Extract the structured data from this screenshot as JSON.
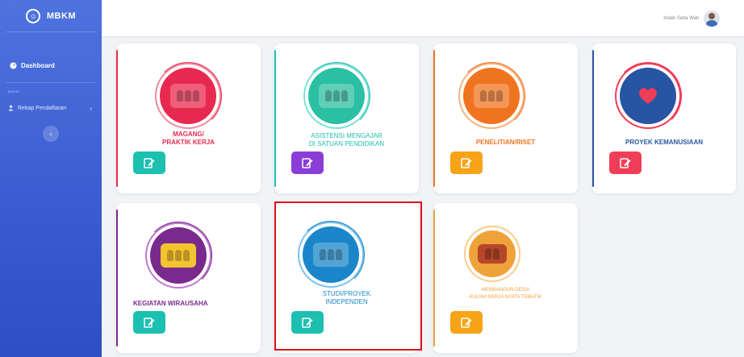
{
  "brand": {
    "name": "MBKM",
    "icon": "smile-logo-icon"
  },
  "sidebar": {
    "dashboard_label": "Dashboard",
    "section_heading": "MBKM",
    "rekap_label": "Rekap Pendaftaran",
    "toggle_icon": "chevron-left-icon"
  },
  "topbar": {
    "user_name": "Indah Setia Wati"
  },
  "cards": [
    {
      "title_1": "MAGANG/",
      "title_2": "PRAKTIK KERJA",
      "accent": "#e8294f",
      "button_color": "#1cbfb0"
    },
    {
      "title_1": "ASISTENSI MENGAJAR",
      "title_2": "DI SATUAN PENDIDIKAN",
      "accent": "#1cbfb0",
      "button_color": "#8a3ed8"
    },
    {
      "title_1": "PENELITIAN/RISET",
      "title_2": "",
      "accent": "#f0731f",
      "button_color": "#f6a317"
    },
    {
      "title_1": "PROYEK KEMANUSIAAN",
      "title_2": "",
      "accent": "#2855a3",
      "button_color": "#ef3e58"
    },
    {
      "title_1": "KEGIATAN WIRAUSAHA",
      "title_2": "",
      "accent": "#7a2a8c",
      "button_color": "#1cbfb0"
    },
    {
      "title_1": "STUDI/PROYEK",
      "title_2": "INDEPENDEN",
      "accent": "#1a86c9",
      "button_color": "#1cbfb0"
    },
    {
      "title_1": "MEMBANGUN DESA/",
      "title_2": "KULIAH KERJA NYATA TEMATIK",
      "accent": "#f0a23a",
      "button_color": "#f6a317"
    }
  ]
}
